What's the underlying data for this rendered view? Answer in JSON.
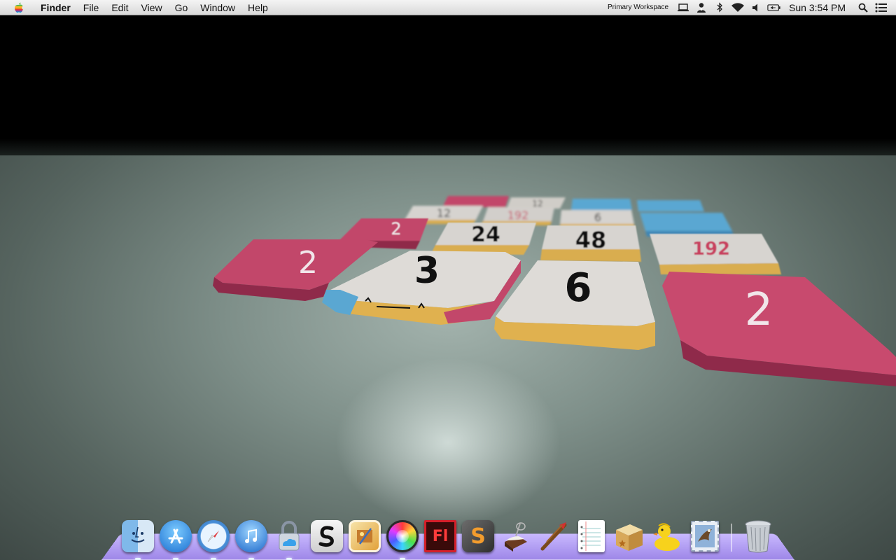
{
  "menubar": {
    "app_name": "Finder",
    "menus": [
      "File",
      "Edit",
      "View",
      "Go",
      "Window",
      "Help"
    ],
    "workspace": "Primary Workspace",
    "clock": "Sun 3:54 PM"
  },
  "wallpaper": {
    "tiles": [
      "12",
      "192",
      "6",
      "12",
      "24",
      "48",
      "192",
      "2",
      "2",
      "3",
      "6",
      "2"
    ]
  },
  "dock": {
    "apps": [
      {
        "name": "Finder",
        "icon": "finder-icon",
        "running": true
      },
      {
        "name": "App Store",
        "icon": "app-store-icon",
        "running": true
      },
      {
        "name": "Safari",
        "icon": "safari-icon",
        "running": true
      },
      {
        "name": "iTunes",
        "icon": "itunes-icon",
        "running": true
      },
      {
        "name": "Cloud Lock",
        "icon": "cloud-lock-icon",
        "running": true
      },
      {
        "name": "Scrivener",
        "icon": "scrivener-icon",
        "running": false
      },
      {
        "name": "iPhoto",
        "icon": "iphoto-icon",
        "running": false
      },
      {
        "name": "Color Picker",
        "icon": "color-wheel-icon",
        "running": true
      },
      {
        "name": "Flash",
        "label": "Fl",
        "icon": "flash-icon",
        "running": false
      },
      {
        "name": "Sublime",
        "label": "S",
        "icon": "sublime-icon",
        "running": false
      },
      {
        "name": "Cakebrew",
        "icon": "cakebrew-icon",
        "running": false
      },
      {
        "name": "Archery",
        "icon": "arrows-icon",
        "running": false
      },
      {
        "name": "Notes",
        "icon": "notes-icon",
        "running": false
      },
      {
        "name": "Archive",
        "icon": "box-icon",
        "running": false
      },
      {
        "name": "Cyberduck",
        "icon": "duck-icon",
        "running": false
      },
      {
        "name": "Mail",
        "icon": "mail-stamp-icon",
        "running": false
      }
    ],
    "trash": {
      "name": "Trash",
      "icon": "trash-icon"
    }
  }
}
